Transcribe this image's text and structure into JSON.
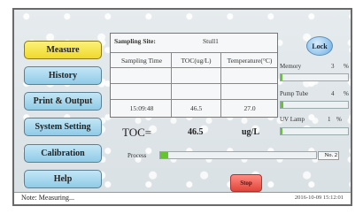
{
  "menu": {
    "measure": "Measure",
    "history": "History",
    "print_output": "Print & Output",
    "system_setting": "System Setting",
    "calibration": "Calibration",
    "help": "Help"
  },
  "table": {
    "site_label": "Sampling Site:",
    "site_value": "Stull1",
    "col_time": "Sampling Time",
    "col_toc": "TOC(ug/L)",
    "col_temp": "Temperature(°C)",
    "row_time": "15:09:48",
    "row_toc": "46.5",
    "row_temp": "27.0"
  },
  "reading": {
    "label": "TOC=",
    "value": "46.5",
    "unit": "ug/L"
  },
  "process": {
    "label": "Process",
    "progress_fraction": 0.05,
    "step": "No. 2"
  },
  "lock_label": "Lock",
  "status_panel": {
    "memory_label": "Memory",
    "memory_value": "3",
    "memory_unit": "%",
    "memory_fraction": 0.03,
    "pump_label": "Pump Tube",
    "pump_value": "4",
    "pump_unit": "%",
    "pump_fraction": 0.04,
    "uv_label": "UV Lamp",
    "uv_value": "1",
    "uv_unit": "%",
    "uv_fraction": 0.01
  },
  "stop_label": "Stop",
  "status_bar": {
    "note": "Note: Measuring...",
    "datetime": "2016-10-09  15:12:01"
  },
  "colors": {
    "menu_active": "#f0d92c",
    "menu_default": "#8fcbe7",
    "progress_fill": "#66c42f",
    "stop_button": "#e2463b",
    "lock_button": "#8cc1ec"
  }
}
